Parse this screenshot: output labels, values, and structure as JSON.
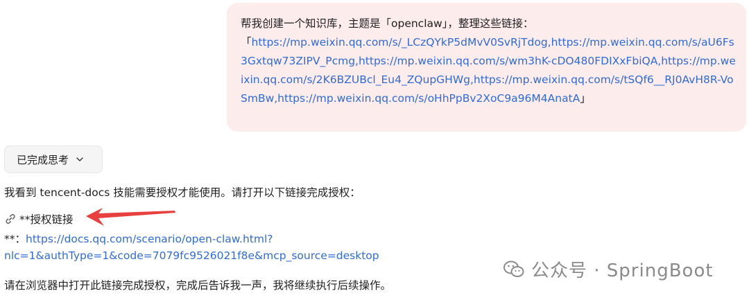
{
  "user_message": {
    "prompt": "帮我创建一个知识库，主题是「openclaw」，整理这些链接：",
    "open_bracket": "「",
    "links_text": "https://mp.weixin.qq.com/s/_LCzQYkP5dMvV0SvRjTdog,https://mp.weixin.qq.com/s/aU6Fs3Gxtqw73ZIPV_Pcmg,https://mp.weixin.qq.com/s/wm3hK-cDO480FDIXxFbiQA,https://mp.weixin.qq.com/s/2K6BZUBcl_Eu4_ZQupGHWg,https://mp.weixin.qq.com/s/tSQf6__RJ0AvH8R-VoSmBw,https://mp.weixin.qq.com/s/oHhPpBv2XoC9a96M4AnatA",
    "close_bracket": "」",
    "bubble_color": "#fdecec"
  },
  "thinking": {
    "label": "已完成思考",
    "icon": "chevron-down-icon"
  },
  "assistant": {
    "intro": "我看到 tencent-docs 技能需要授权才能使用。请打开以下链接完成授权：",
    "auth_icon": "link-icon",
    "auth_label": "**授权链接",
    "url_prefix": "**：",
    "url_line1": "https://docs.qq.com/scenario/open-claw.html?",
    "url_line2": "nlc=1&authType=1&code=7079fc9526021f8e&mcp_source=desktop",
    "final": "请在浏览器中打开此链接完成授权，完成后告诉我一声，我将继续执行后续操作。",
    "link_color": "#2f6bd8"
  },
  "annotation": {
    "arrow_color": "#e8403f"
  },
  "watermark": {
    "icon": "wechat-icon",
    "text": "公众号 · SpringBoot"
  }
}
